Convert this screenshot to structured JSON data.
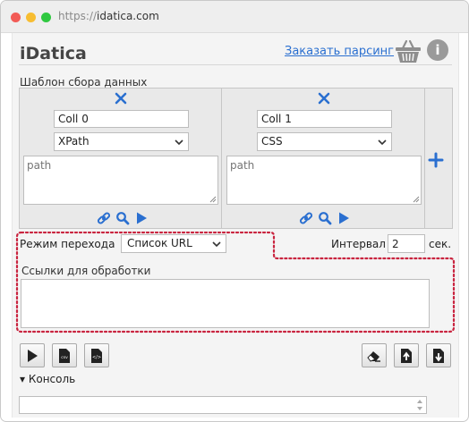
{
  "browser": {
    "url_protocol": "https://",
    "url_domain": "idatica.com"
  },
  "header": {
    "brand": "iDatica",
    "order_link": "Заказать парсинг",
    "icons": [
      "basket-icon",
      "info-icon"
    ],
    "info_glyph": "i"
  },
  "template": {
    "label": "Шаблон сбора данных",
    "columns": [
      {
        "name": "Coll 0",
        "selector_type": "XPath",
        "path_placeholder": "path"
      },
      {
        "name": "Coll 1",
        "selector_type": "CSS",
        "path_placeholder": "path"
      }
    ],
    "column_icons": [
      "delete-icon",
      "link-icon",
      "search-icon",
      "play-icon"
    ],
    "add_icon": "plus-icon"
  },
  "navigation": {
    "mode_label": "Режим перехода",
    "mode_value": "Список URL",
    "interval_label": "Интервал",
    "interval_value": "2",
    "interval_unit": "сек."
  },
  "links": {
    "label": "Ссылки для обработки",
    "value": ""
  },
  "toolbar": {
    "left_buttons": [
      "play-button",
      "csv-export-button",
      "code-export-button"
    ],
    "right_buttons": [
      "eraser-button",
      "upload-button",
      "download-button"
    ],
    "csv_text": "csv",
    "code_text": "</>"
  },
  "console": {
    "label": "▾ Консоль",
    "value": ""
  },
  "colors": {
    "accent_blue": "#2a6fd0",
    "highlight_red": "#c9243f",
    "panel_bg": "#f4f4f4"
  }
}
